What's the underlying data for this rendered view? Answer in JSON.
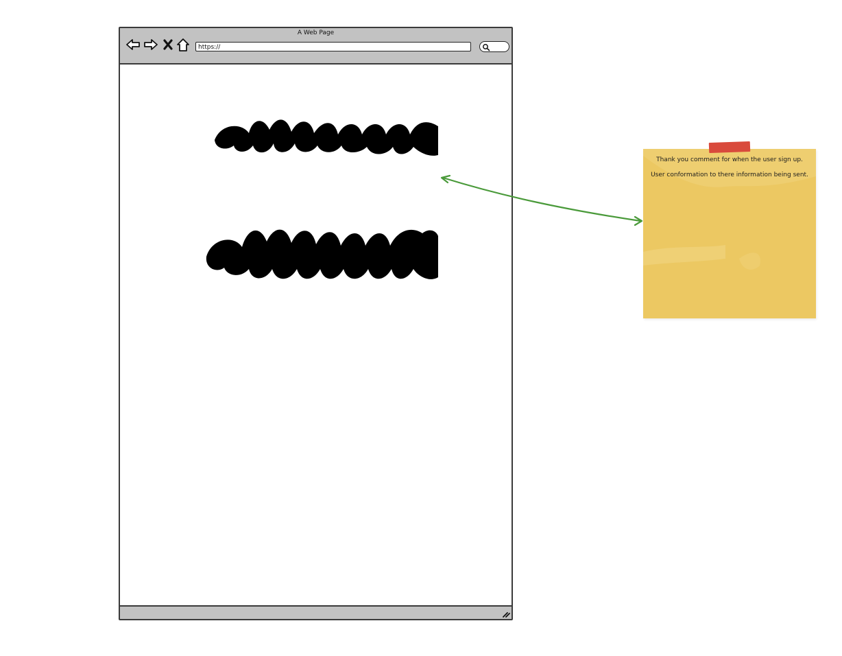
{
  "browser": {
    "page_title": "A Web Page",
    "url": "https://",
    "nav": {
      "back_icon": "arrow-left-icon",
      "forward_icon": "arrow-right-icon",
      "stop_icon": "close-icon",
      "home_icon": "home-icon"
    },
    "search_icon": "search-icon",
    "content_placeholder": "redacted scribble text blocks (2)"
  },
  "sticky_note": {
    "lines": [
      "Thank you comment for when the user sign up.",
      "User conformation to there information being sent."
    ],
    "color": "#ecc862",
    "tape_color": "#d94a3c"
  },
  "connector": {
    "color": "#4a9a3a",
    "style": "double-headed arrow"
  }
}
